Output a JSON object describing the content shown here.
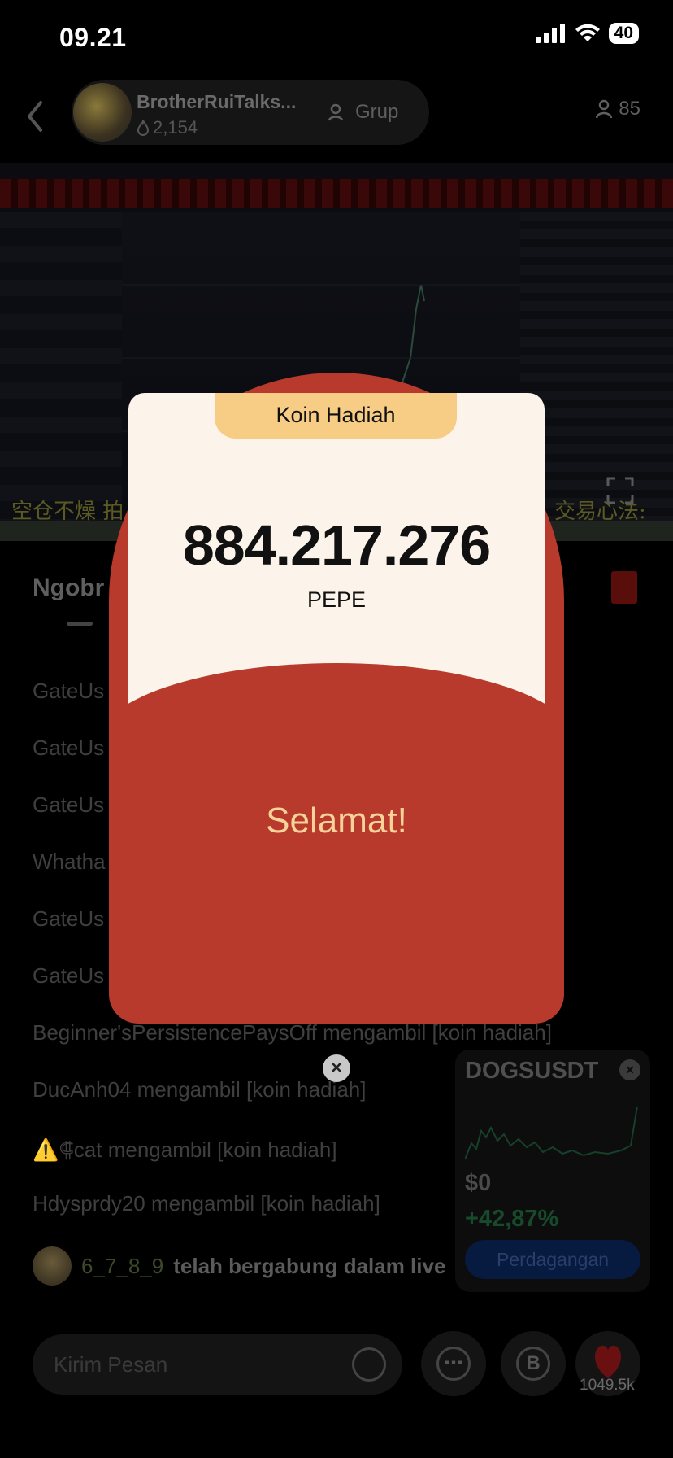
{
  "status_bar": {
    "time": "09.21",
    "battery": "40"
  },
  "header": {
    "host_name": "BrotherRuiTalks...",
    "host_likes": "2,154",
    "group_label": "Grup",
    "viewers": "85"
  },
  "video": {
    "caption_left": "空仓不燥 拍",
    "caption_right": "交易心法:"
  },
  "chat": {
    "tab_title": "Ngobr",
    "messages": [
      "GateUs",
      "GateUs",
      "GateUs",
      "Whatha",
      "GateUs",
      "GateUs",
      "Beginner'sPersistencePaysOff mengambil [koin hadiah]",
      "DucAnh04 mengambil [koin hadiah]",
      "⚠️⸿cat mengambil [koin hadiah]",
      "Hdysprdy20 mengambil [koin hadiah]"
    ],
    "join_user": "6_7_8_9",
    "join_text": "telah bergabung dalam live"
  },
  "bottom_bar": {
    "message_placeholder": "Kirim Pesan",
    "heart_count": "1049.5k"
  },
  "ticker": {
    "symbol": "DOGSUSDT",
    "price": "$0",
    "change": "+42,87%",
    "trade_button": "Perdagangan",
    "colors": {
      "change": "#174a2c",
      "button": "#061b3f"
    }
  },
  "reward_modal": {
    "title": "Koin Hadiah",
    "amount": "884.217.276",
    "coin": "PEPE",
    "message": "Selamat!",
    "colors": {
      "envelope": "#b83a2c",
      "card": "#fcf4ea",
      "tab": "#f7cd86",
      "message": "#f7d39a"
    }
  }
}
